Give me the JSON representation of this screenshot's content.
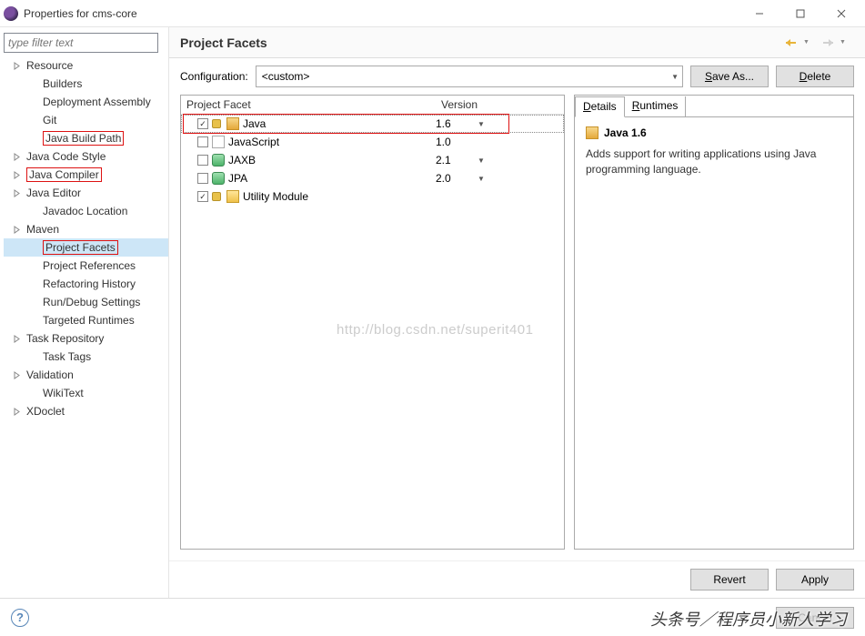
{
  "title": "Properties for cms-core",
  "filter_placeholder": "type filter text",
  "tree": [
    {
      "label": "Resource",
      "exp": true
    },
    {
      "label": "Builders",
      "child": true
    },
    {
      "label": "Deployment Assembly",
      "child": true
    },
    {
      "label": "Git",
      "child": true
    },
    {
      "label": "Java Build Path",
      "child": true,
      "red": true
    },
    {
      "label": "Java Code Style",
      "exp": true
    },
    {
      "label": "Java Compiler",
      "exp": true,
      "red": true
    },
    {
      "label": "Java Editor",
      "exp": true
    },
    {
      "label": "Javadoc Location",
      "child": true
    },
    {
      "label": "Maven",
      "exp": true
    },
    {
      "label": "Project Facets",
      "child": true,
      "red": true,
      "sel": true
    },
    {
      "label": "Project References",
      "child": true
    },
    {
      "label": "Refactoring History",
      "child": true
    },
    {
      "label": "Run/Debug Settings",
      "child": true
    },
    {
      "label": "Targeted Runtimes",
      "child": true
    },
    {
      "label": "Task Repository",
      "exp": true
    },
    {
      "label": "Task Tags",
      "child": true
    },
    {
      "label": "Validation",
      "exp": true
    },
    {
      "label": "WikiText",
      "child": true
    },
    {
      "label": "XDoclet",
      "exp": true
    }
  ],
  "page_heading": "Project Facets",
  "config_label": "Configuration:",
  "config_value": "<custom>",
  "save_as": "Save As...",
  "delete": "Delete",
  "facet_cols": {
    "c1": "Project Facet",
    "c2": "Version"
  },
  "facets": [
    {
      "name": "Java",
      "version": "1.6",
      "checked": true,
      "dd": true,
      "icon": "java",
      "locked": true,
      "hl": true,
      "sel": true
    },
    {
      "name": "JavaScript",
      "version": "1.0",
      "checked": false,
      "dd": false,
      "icon": "js"
    },
    {
      "name": "JAXB",
      "version": "2.1",
      "checked": false,
      "dd": true,
      "icon": "jaxb"
    },
    {
      "name": "JPA",
      "version": "2.0",
      "checked": false,
      "dd": true,
      "icon": "jpa"
    },
    {
      "name": "Utility Module",
      "version": "",
      "checked": true,
      "dd": false,
      "icon": "util",
      "locked": true
    }
  ],
  "tabs": {
    "details": "Details",
    "runtimes": "Runtimes"
  },
  "detail_title": "Java 1.6",
  "detail_body": "Adds support for writing applications using Java programming language.",
  "revert": "Revert",
  "apply": "Apply",
  "cancel": "Cancel",
  "watermark": "http://blog.csdn.net/superit401",
  "watermark2": "头条号／程序员小新人学习"
}
